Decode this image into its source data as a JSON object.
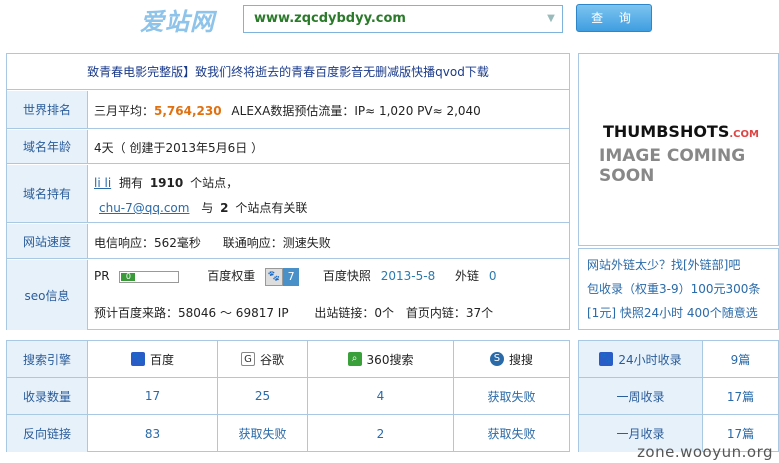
{
  "header": {
    "logo": "爱站网",
    "search_value": "www.zqcdybdyy.com",
    "query_button": "查 询"
  },
  "title_link": "致青春电影完整版】致我们终将逝去的青春百度影音无删减版快播qvod下载",
  "rows": {
    "world_rank": {
      "label": "世界排名",
      "prefix": "三月平均：",
      "rank": "5,764,230",
      "alexa": "ALEXA数据预估流量：IP≈ 1,020 PV≈ 2,040"
    },
    "domain_age": {
      "label": "域名年龄",
      "value": "4天（ 创建于2013年5月6日 ）"
    },
    "domain_owner": {
      "label": "域名持有",
      "owner": "li li",
      "own_prefix": "拥有",
      "own_count": "1910",
      "own_suffix": "个站点，",
      "email": "chu-7@qq.com",
      "rel_prefix": "与",
      "rel_count": "2",
      "rel_suffix": "个站点有关联"
    },
    "speed": {
      "label": "网站速度",
      "telecom": "电信响应：562毫秒",
      "unicom": "联通响应：测速失败"
    },
    "seo": {
      "label": "seo信息",
      "pr_label": "PR",
      "pr_value": "0",
      "bd_weight_label": "百度权重",
      "bd_weight_value": "7",
      "snapshot_label": "百度快照",
      "snapshot_value": "2013-5-8",
      "outlink_label": "外链",
      "outlink_value": "0",
      "forecast": "预计百度来路：58046 ～ 69817 IP",
      "out_links": "出站链接：0个",
      "home_links": "首页内链：37个"
    }
  },
  "thumbnail": {
    "brand": "THUMBSHOTS",
    "dotcom": ".COM",
    "coming_soon": "IMAGE COMING SOON"
  },
  "ads": [
    "网站外链太少？找[外链部]吧",
    "包收录（权重3-9）100元300条",
    "[1元] 快照24小时  400个随意选"
  ],
  "search_table": {
    "headers": [
      "搜索引擎",
      "百度",
      "谷歌",
      "360搜索",
      "搜搜"
    ],
    "rows": [
      [
        "收录数量",
        "17",
        "25",
        "4",
        "获取失败"
      ],
      [
        "反向链接",
        "83",
        "获取失败",
        "2",
        "获取失败"
      ]
    ]
  },
  "index_table": {
    "rows": [
      [
        "24小时收录",
        "9篇"
      ],
      [
        "一周收录",
        "17篇"
      ],
      [
        "一月收录",
        "17篇"
      ]
    ]
  },
  "watermark": "zone.wooyun.org",
  "colors": {
    "accent": "#3f9ee0",
    "rank_orange": "#e07010",
    "label_bg": "#e7f1fa",
    "border": "#a9c8e2"
  }
}
